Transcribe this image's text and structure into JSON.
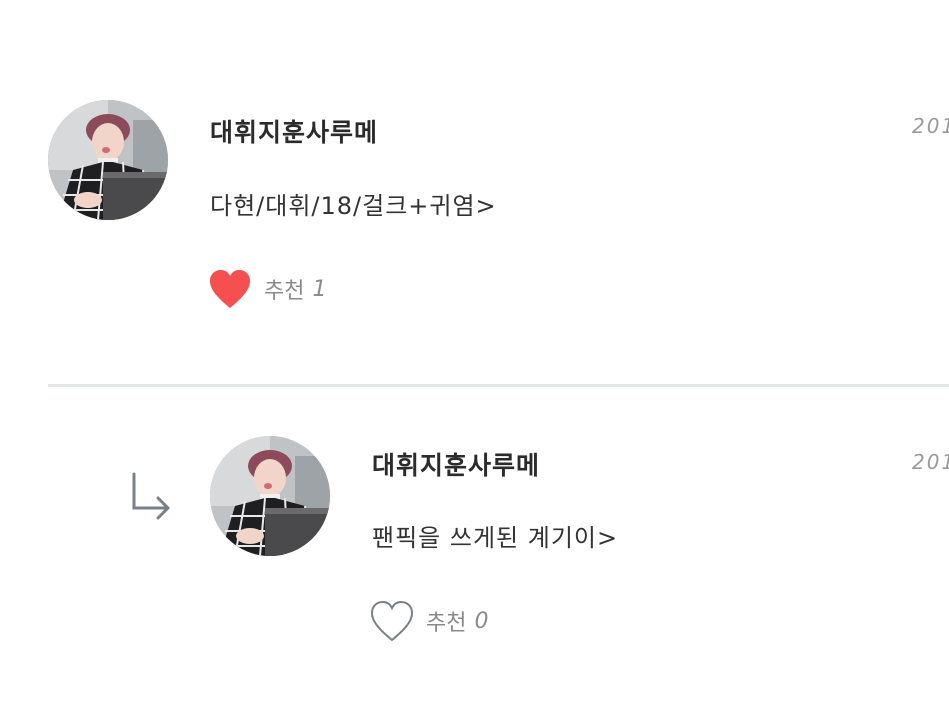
{
  "comments": [
    {
      "username": "대휘지훈사루메",
      "date": "201",
      "content": "다현/대휘/18/걸크+귀염>",
      "like_label": "추천",
      "like_count": "1",
      "liked": true
    },
    {
      "username": "대휘지훈사루메",
      "date": "201",
      "content": "팬픽을 쓰게된 계기이>",
      "like_label": "추천",
      "like_count": "0",
      "liked": false,
      "is_reply": true
    }
  ],
  "colors": {
    "heart_filled": "#f5504f",
    "heart_outline": "#7a8088",
    "divider": "#e3e7ea"
  }
}
